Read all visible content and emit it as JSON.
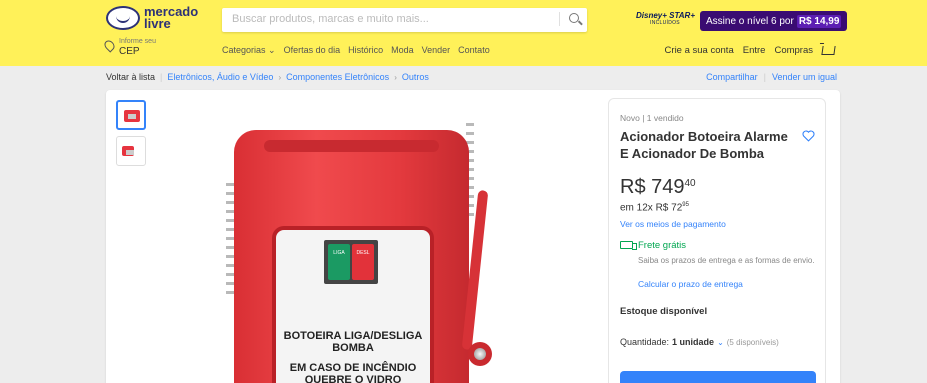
{
  "header": {
    "logo_line1": "mercado",
    "logo_line2": "livre",
    "search_placeholder": "Buscar produtos, marcas e muito mais...",
    "disney_top": "Disney+ STAR+",
    "disney_bottom": "INCLUÍDOS",
    "promo_text": "Assine o nível 6 por",
    "promo_price": "R$ 14,99",
    "location_small": "Informe seu",
    "location_cep": "CEP",
    "nav": [
      "Categorias ⌄",
      "Ofertas do dia",
      "Histórico",
      "Moda",
      "Vender",
      "Contato"
    ],
    "user_nav": [
      "Crie a sua conta",
      "Entre",
      "Compras"
    ]
  },
  "breadcrumb": {
    "back": "Voltar à lista",
    "items": [
      "Eletrônicos, Áudio e Vídeo",
      "Componentes Eletrônicos",
      "Outros"
    ],
    "share": "Compartilhar",
    "sell_same": "Vender um igual"
  },
  "product_image": {
    "buttons": [
      "LIGA",
      "DESL"
    ],
    "label_line1": "BOTOEIRA LIGA/DESLIGA",
    "label_line2": "BOMBA",
    "label_line3": "EM CASO DE INCÊNDIO",
    "label_line4": "QUEBRE O VIDRO"
  },
  "buybox": {
    "condition": "Novo  |  1 vendido",
    "title": "Acionador Botoeira Alarme E Acionador De Bomba",
    "price_main": "R$ 749",
    "price_cents": "40",
    "installment": "em 12x R$ 72",
    "installment_cents": "95",
    "payment_link": "Ver os meios de pagamento",
    "free_shipping": "Frete grátis",
    "shipping_desc": "Saiba os prazos de entrega e as formas de envio.",
    "calc_link": "Calcular o prazo de entrega",
    "stock": "Estoque disponível",
    "qty_label": "Quantidade:",
    "qty_value": "1 unidade",
    "qty_avail": "(5 disponíveis)"
  },
  "colors": {
    "header_bg": "#fff159",
    "link": "#3483fa",
    "free_shipping": "#00a650",
    "promo_bg": "#3a0c72"
  }
}
